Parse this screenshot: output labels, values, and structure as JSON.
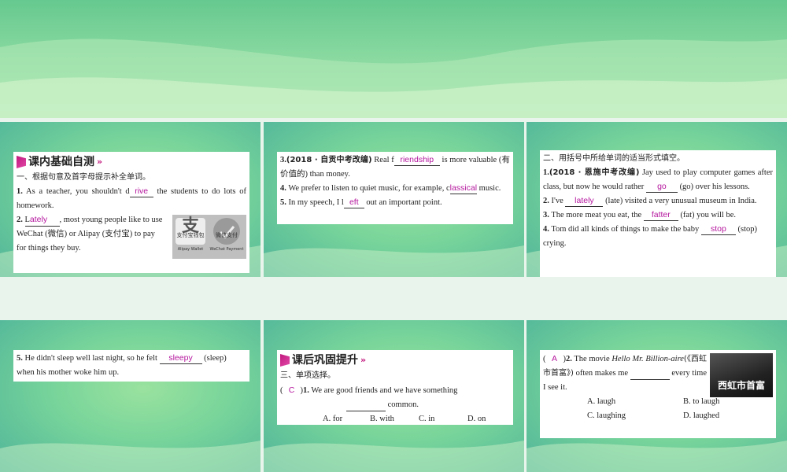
{
  "p1": {
    "section_title": "课内基础自测",
    "subtitle": "一、根据句意及首字母提示补全单词。",
    "q1_num": "1.",
    "q1_a": "As a teacher, you shouldn't d",
    "q1_ans": "rive",
    "q1_b": "the students to do lots of homework.",
    "q2_num": "2.",
    "q2_prefix": "L",
    "q2_ans": "ately",
    "q2_a": ", most young people like to use WeChat (微信) or Alipay (支付宝) to pay for things they buy.",
    "alipay_caption": "支付宝钱包",
    "alipay_sub": "Alipay Wallet",
    "wechat_caption": "微信支付",
    "wechat_sub": "WeChat Payment",
    "alipay_glyph": "支"
  },
  "p2": {
    "q3_num": "3.",
    "q3_src": "(2018 · 自贡中考改编)",
    "q3_a": "Real f",
    "q3_ans": "riendship",
    "q3_b": "is more valuable (有价值的) than money.",
    "q4_num": "4.",
    "q4_a": "We prefer to listen to quiet music, for example, c",
    "q4_ans": "lassical",
    "q4_b": "music.",
    "q5_num": "5.",
    "q5_a": "In my speech, I l",
    "q5_ans": "eft",
    "q5_b": "out an important point."
  },
  "p3": {
    "subtitle": "二、用括号中所给单词的适当形式填空。",
    "q1_num": "1.",
    "q1_src": "(2018 · 恩施中考改编)",
    "q1_a": "Jay used to play computer games after class, but now he would rather",
    "q1_ans": "go",
    "q1_b": "(go) over his lessons.",
    "q2_num": "2.",
    "q2_a": "I've",
    "q2_ans": "lately",
    "q2_b": "(late) visited a very unusual museum in India.",
    "q3_num": "3.",
    "q3_a": "The more meat you eat, the",
    "q3_ans": "fatter",
    "q3_b": "(fat) you will be.",
    "q4_num": "4.",
    "q4_a": "Tom did all kinds of things to make the baby",
    "q4_ans": "stop",
    "q4_b": "(stop) crying."
  },
  "p4": {
    "q5_num": "5.",
    "q5_a": "He didn't sleep well last night, so he felt",
    "q5_ans": "sleepy",
    "q5_b": "(sleep) when his mother woke him up."
  },
  "p5": {
    "section_title": "课后巩固提升",
    "subtitle": "三、单项选择。",
    "q1_ans": "C",
    "q1_num": "1.",
    "q1_a": "We are good friends and we have something",
    "q1_b": "common.",
    "opt_a": "A. for",
    "opt_b": "B. with",
    "opt_c": "C. in",
    "opt_d": "D. on"
  },
  "p6": {
    "q2_ans": "A",
    "q2_num": "2.",
    "q2_a": "The movie",
    "q2_title": "Hello Mr. Billion-aire",
    "q2_cn": "(《西虹市首富》)",
    "q2_b": "often makes me",
    "q2_c": "every time I see it.",
    "opt_a": "A. laugh",
    "opt_b": "B. to laugh",
    "opt_c": "C. laughing",
    "opt_d": "D. laughed",
    "poster_text": "西虹市首富"
  }
}
